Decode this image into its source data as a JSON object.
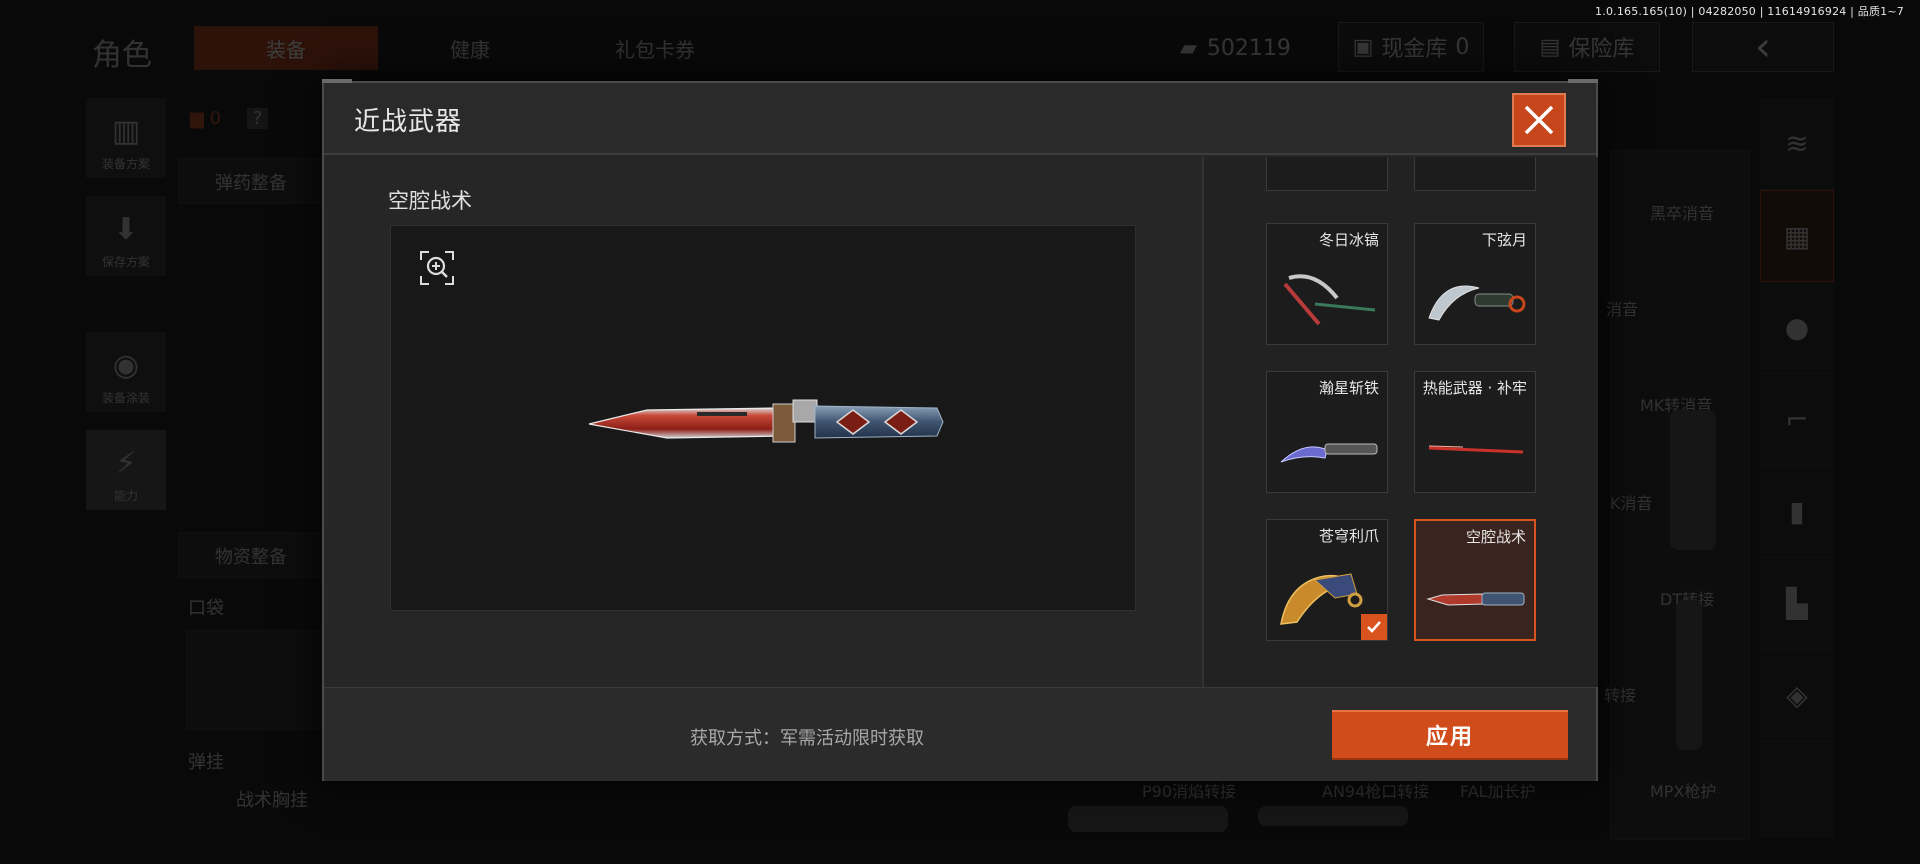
{
  "version_info": "1.0.165.165(10) | 04282050 | 11614916924 | 品质1~7",
  "background": {
    "page_title": "角色",
    "tabs": [
      "装备",
      "健康",
      "礼包卡券"
    ],
    "currency_amount": "502119",
    "cash_vault_label": "现金库",
    "cash_vault_count": "0",
    "safe_label": "保险库",
    "left_buttons": [
      "装备方案",
      "保存方案",
      "装备涂装",
      "能力"
    ],
    "armor_count": "0",
    "armor_help": "?",
    "ammo_supply_label": "弹药整备",
    "material_supply_label": "物资整备",
    "pocket_label": "口袋",
    "hang_label": "弹挂",
    "vest_label": "战术胸挂",
    "attachments": [
      "黑卒消音",
      "消音",
      "MK转消音",
      "K消音",
      "DT转接",
      "转接",
      "P90消焰转接",
      "AN94枪口转接",
      "FAL加长护",
      "MPX枪护"
    ]
  },
  "modal": {
    "title": "近战武器",
    "selected_weapon_name": "空腔战术",
    "weapons": [
      {
        "name": "冬日冰镐",
        "selected": false,
        "equipped": false
      },
      {
        "name": "下弦月",
        "selected": false,
        "equipped": false
      },
      {
        "name": "瀚星斩铁",
        "selected": false,
        "equipped": false
      },
      {
        "name": "热能武器 · 补牢",
        "selected": false,
        "equipped": false
      },
      {
        "name": "苍穹利爪",
        "selected": false,
        "equipped": true
      },
      {
        "name": "空腔战术",
        "selected": true,
        "equipped": false
      }
    ],
    "acquire_text": "获取方式：军需活动限时获取",
    "apply_label": "应用"
  },
  "colors": {
    "accent": "#d04c1a",
    "selected_border": "#d9531f",
    "panel": "#262626"
  }
}
